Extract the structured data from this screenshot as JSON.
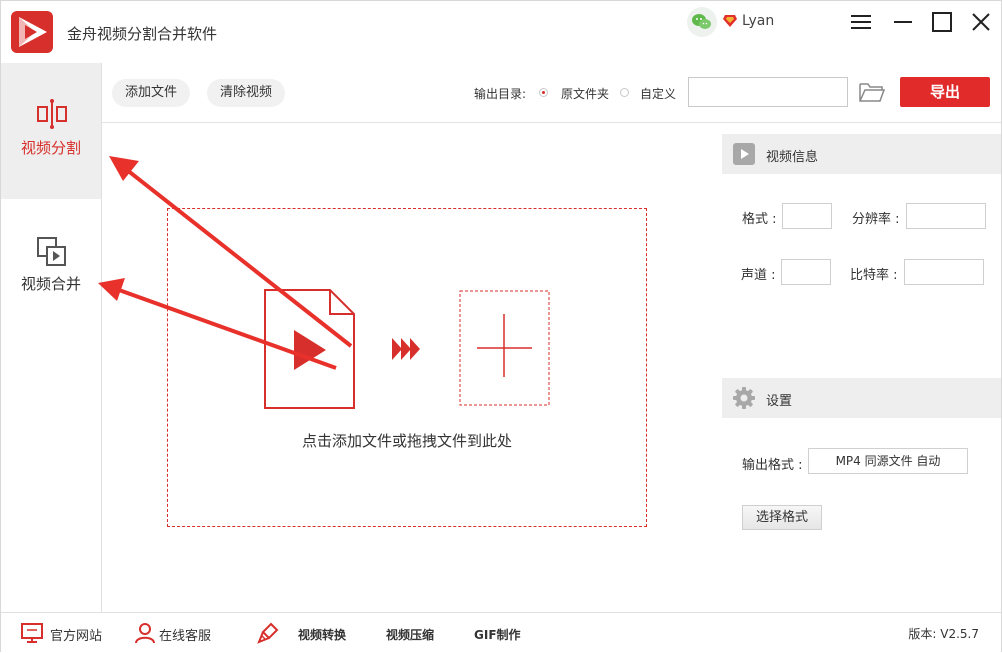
{
  "app": {
    "title": "金舟视频分割合并软件",
    "user_name": "Lyan",
    "accent_color": "#d72f2b"
  },
  "sidebar": {
    "items": [
      {
        "label": "视频分割",
        "icon": "split-icon",
        "active": true
      },
      {
        "label": "视频合并",
        "icon": "merge-icon",
        "active": false
      }
    ]
  },
  "toolbar": {
    "add_file_label": "添加文件",
    "clear_label": "清除视频",
    "output_dir_label": "输出目录:",
    "radio_source_label": "原文件夹",
    "radio_custom_label": "自定义",
    "selected_output": "原文件夹",
    "path_value": "",
    "export_label": "导出"
  },
  "drop_zone": {
    "hint": "点击添加文件或拖拽文件到此处"
  },
  "video_info": {
    "title": "视频信息",
    "format_label": "格式 :",
    "resolution_label": "分辨率 :",
    "channel_label": "声道 :",
    "bitrate_label": "比特率 :"
  },
  "settings": {
    "title": "设置",
    "output_format_label": "输出格式 :",
    "output_format_value": "MP4 同源文件 自动",
    "choose_format_label": "选择格式"
  },
  "footer": {
    "website_label": "官方网站",
    "support_label": "在线客服",
    "convert_label": "视频转换",
    "compress_label": "视频压缩",
    "gif_label": "GIF制作",
    "version_label": "版本: V2.5.7"
  }
}
